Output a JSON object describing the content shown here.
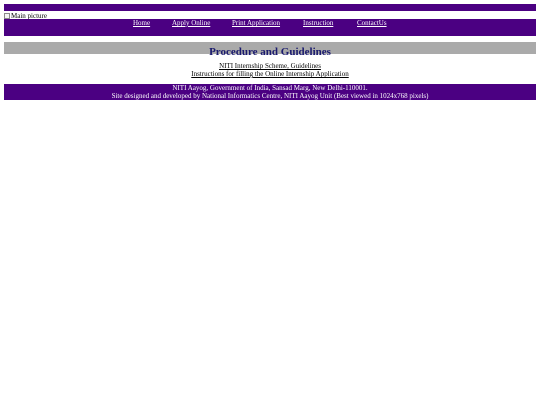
{
  "colors": {
    "bar": "#4b0082",
    "heading_bar": "#aaaaaa",
    "title_text": "#1a1a6e",
    "link_text": "#ffffff"
  },
  "header": {
    "main_picture_alt": "Main picture",
    "image_icon": "broken-image-icon"
  },
  "nav": {
    "items": [
      {
        "label": "Home"
      },
      {
        "label": "Apply Online"
      },
      {
        "label": "Print Application"
      },
      {
        "label": "Instruction"
      },
      {
        "label": "ContactUs"
      }
    ]
  },
  "main": {
    "title": "Procedure and Guidelines",
    "links": [
      {
        "label": "NITI Internship Scheme, Guidelines"
      },
      {
        "label": "Instructions for filling the Online Internship Application"
      }
    ]
  },
  "footer": {
    "line1": "NITI Aayog, Government of India, Sansad Marg, New Delhi-110001.",
    "line2": "Site designed and developed by National Informatics Centre, NITI Aayog Unit (Best viewed in 1024x768 pixels)"
  }
}
